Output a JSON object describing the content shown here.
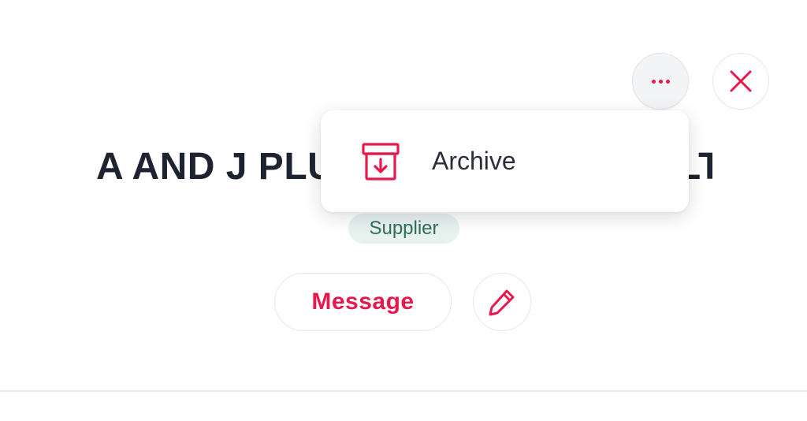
{
  "header": {
    "more_button_icon": "more-horizontal-icon",
    "close_button_icon": "close-icon"
  },
  "profile": {
    "title": "A AND J PLUMBING COMPANY LTD.",
    "badge": "Supplier"
  },
  "actions": {
    "message_label": "Message",
    "edit_icon": "pencil-icon"
  },
  "menu": {
    "items": [
      {
        "label": "Archive",
        "icon": "archive-icon"
      }
    ]
  },
  "colors": {
    "accent": "#e8184c",
    "title": "#1d2330",
    "badge_bg": "#e7f1ee",
    "badge_text": "#2f6f5e"
  }
}
